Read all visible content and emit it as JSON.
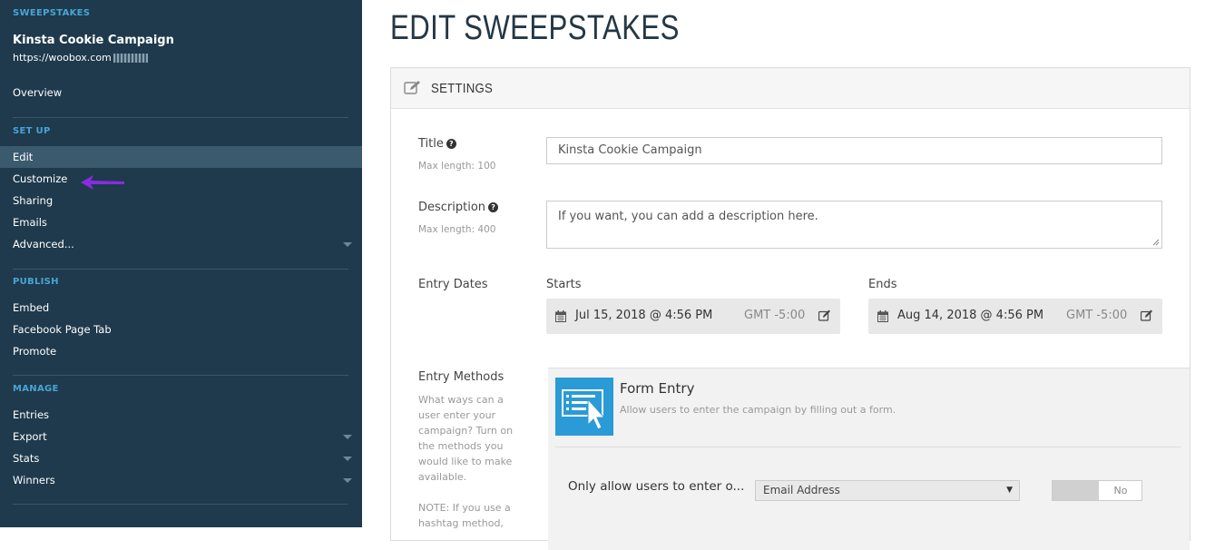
{
  "sidebar": {
    "section_sweepstakes": "SWEEPSTAKES",
    "campaign_title": "Kinsta Cookie Campaign",
    "campaign_url": "https://woobox.com",
    "overview": "Overview",
    "section_setup": "SET UP",
    "setup_items": [
      "Edit",
      "Customize",
      "Sharing",
      "Emails",
      "Advanced..."
    ],
    "section_publish": "PUBLISH",
    "publish_items": [
      "Embed",
      "Facebook Page Tab",
      "Promote"
    ],
    "section_manage": "MANAGE",
    "manage_items": [
      "Entries",
      "Export",
      "Stats",
      "Winners"
    ],
    "active_item": "Edit",
    "arrow_color": "#8a2be2"
  },
  "main": {
    "page_title": "EDIT SWEEPSTAKES",
    "panel_title": "SETTINGS",
    "title_field": {
      "label": "Title",
      "hint": "Max length: 100",
      "value": "Kinsta Cookie Campaign"
    },
    "description_field": {
      "label": "Description",
      "hint": "Max length: 400",
      "placeholder": "If you want, you can add a description here."
    },
    "entry_dates": {
      "label": "Entry Dates",
      "starts_label": "Starts",
      "starts_value": "Jul 15, 2018 @ 4:56 PM",
      "starts_tz": "GMT -5:00",
      "ends_label": "Ends",
      "ends_value": "Aug 14, 2018 @ 4:56 PM",
      "ends_tz": "GMT -5:00"
    },
    "entry_methods": {
      "label": "Entry Methods",
      "help": "What ways can a user enter your campaign? Turn on the methods you would like to make available.",
      "note": "NOTE: If you use a hashtag method,",
      "form_entry_title": "Form Entry",
      "form_entry_desc": "Allow users to enter the campaign by filling out a form.",
      "only_allow_label": "Only allow users to enter o...",
      "select_value": "Email Address",
      "toggle_value": "No"
    }
  },
  "colors": {
    "sidebar_bg": "#1e3a4c",
    "sidebar_section": "#48a5d6",
    "active_item_bg": "#3b5a6e",
    "form_entry_icon": "#2a9bd6"
  }
}
